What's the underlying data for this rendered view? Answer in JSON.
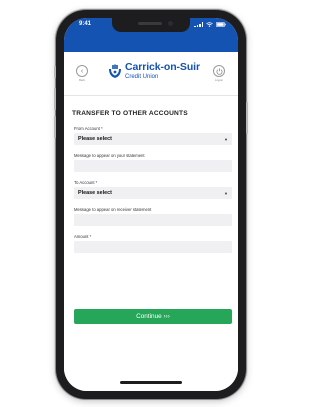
{
  "status": {
    "time": "9:41"
  },
  "header": {
    "back_label": "Back",
    "logout_label": "Logout",
    "logo_name": "Carrick-on-Suir",
    "logo_sub": "Credit Union"
  },
  "page": {
    "title": "TRANSFER TO OTHER ACCOUNTS"
  },
  "form": {
    "from_label": "From Account *",
    "from_value": "Please select",
    "msg_statement_label": "Message to appear on your statement",
    "to_label": "To Account *",
    "to_value": "Please select",
    "msg_receiver_label": "Message to appear on receiver statement",
    "amount_label": "Amount *"
  },
  "continue_label": "Continue ›››",
  "colors": {
    "brand": "#1453b2",
    "accent": "#26a658"
  }
}
